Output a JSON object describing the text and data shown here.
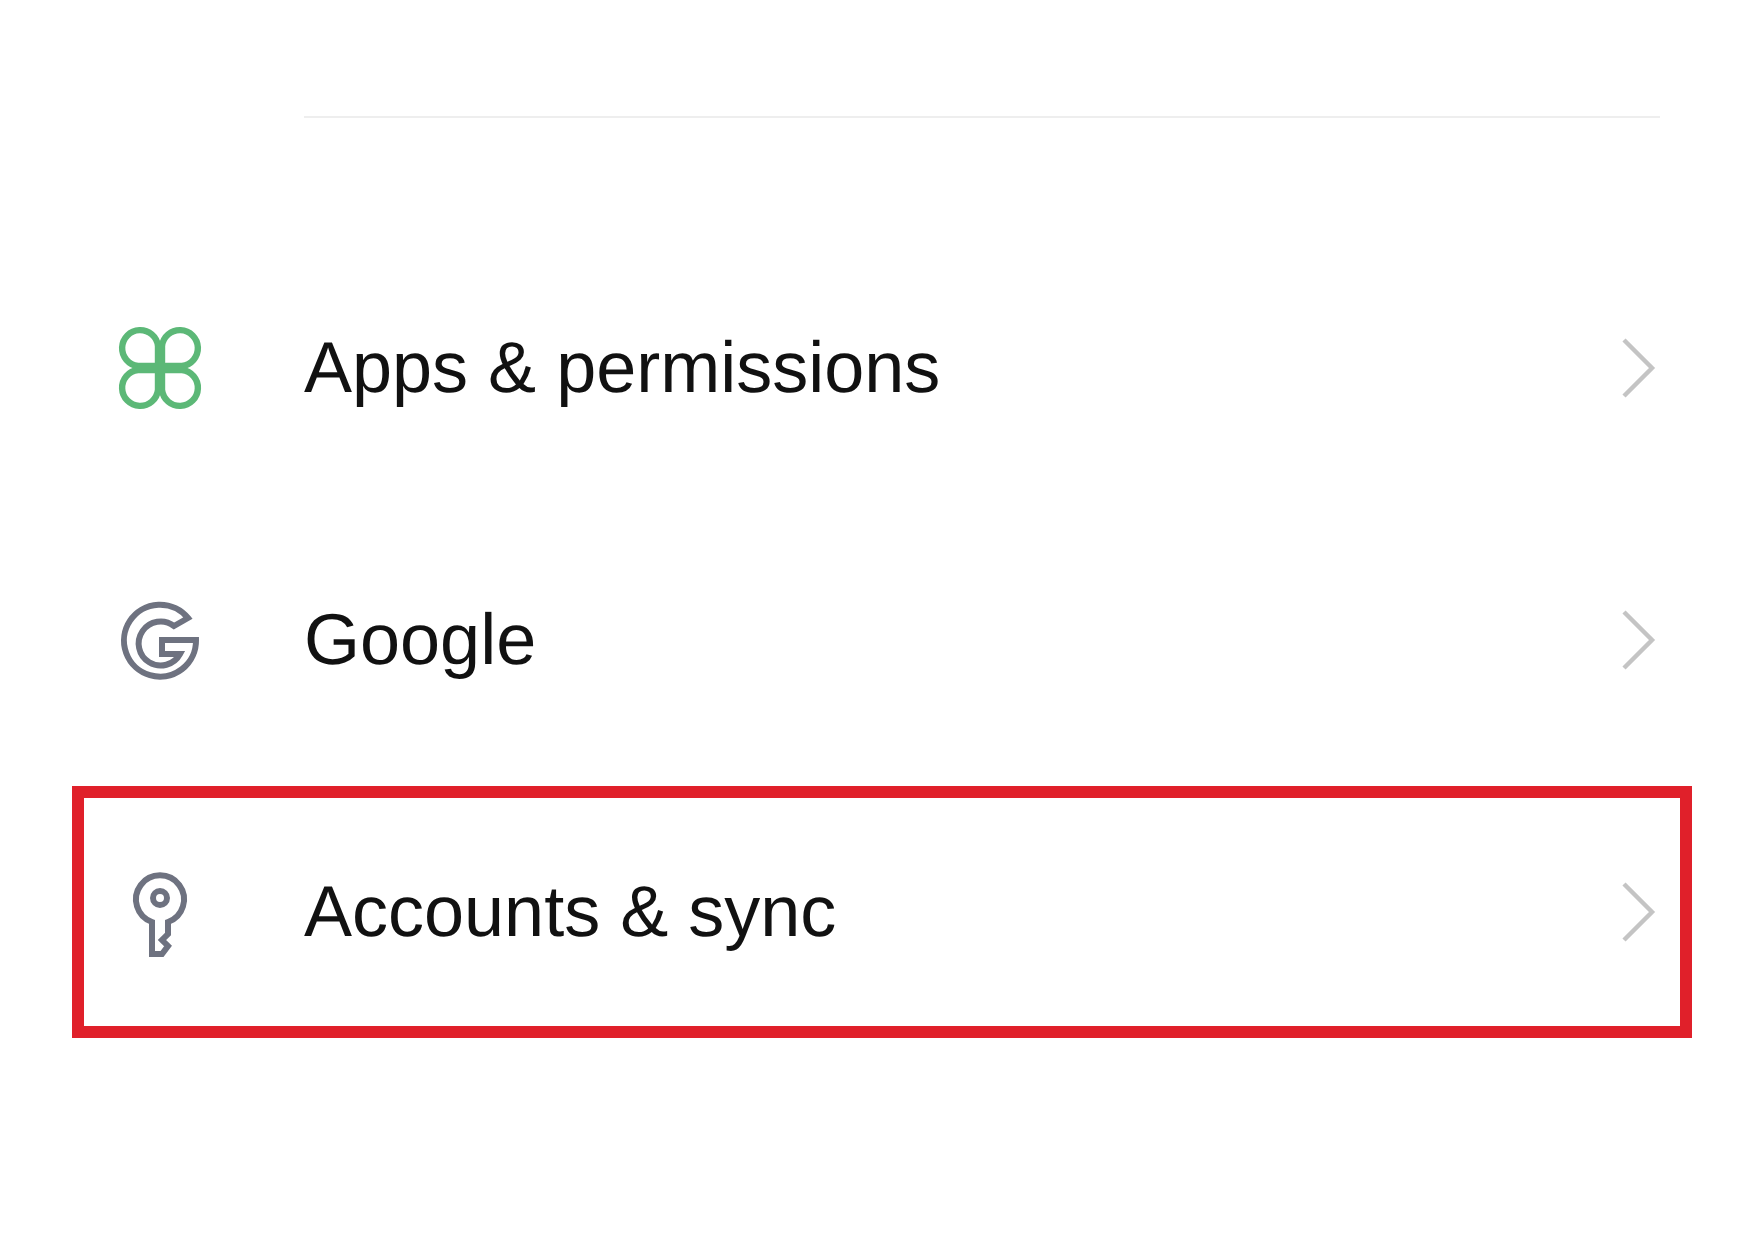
{
  "settings_items": [
    {
      "kind": "apps",
      "label": "Apps & permissions",
      "highlighted": false
    },
    {
      "kind": "google",
      "label": "Google",
      "highlighted": false
    },
    {
      "kind": "accounts",
      "label": "Accounts & sync",
      "highlighted": true
    }
  ]
}
